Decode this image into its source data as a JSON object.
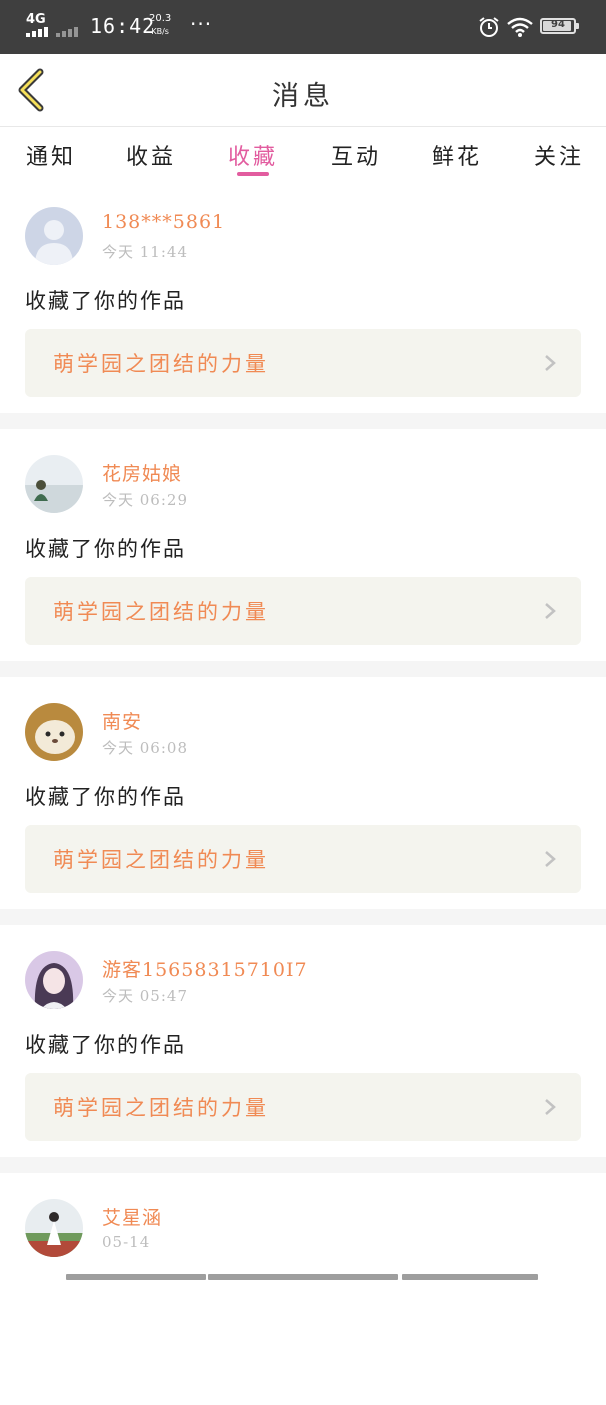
{
  "status_bar": {
    "network": "4G",
    "time": "16:42",
    "speed_value": "20.3",
    "speed_unit": "KB/s",
    "more": "···",
    "battery": "94",
    "icons": [
      "signal-icon",
      "alarm-icon",
      "wifi-icon",
      "battery-icon"
    ]
  },
  "header": {
    "title": "消息",
    "back_icon": "chevron-left-icon"
  },
  "tabs": [
    {
      "label": "通知"
    },
    {
      "label": "收益"
    },
    {
      "label": "收藏",
      "active": true
    },
    {
      "label": "互动"
    },
    {
      "label": "鲜花"
    },
    {
      "label": "关注"
    }
  ],
  "messages": [
    {
      "user": "138***5861",
      "time": "今天 11:44",
      "action": "收藏了你的作品",
      "work": "萌学园之团结的力量",
      "avatar": "default-avatar-icon"
    },
    {
      "user": "花房姑娘",
      "time": "今天 06:29",
      "action": "收藏了你的作品",
      "work": "萌学园之团结的力量",
      "avatar": "girl-photo"
    },
    {
      "user": "南安",
      "time": "今天 06:08",
      "action": "收藏了你的作品",
      "work": "萌学园之团结的力量",
      "avatar": "cat-photo"
    },
    {
      "user": "游客15658315710I7",
      "time": "今天 05:47",
      "action": "收藏了你的作品",
      "work": "萌学园之团结的力量",
      "avatar": "anime-girl-photo"
    },
    {
      "user": "艾星涵",
      "time": "05-14",
      "action": "",
      "work": "",
      "avatar": "outdoor-photo"
    }
  ],
  "colors": {
    "accent": "#e25c9f",
    "username": "#f08a54",
    "work_title": "#f08a54",
    "status_bar": "#3f3f3f",
    "work_box": "#f4f4ee"
  }
}
